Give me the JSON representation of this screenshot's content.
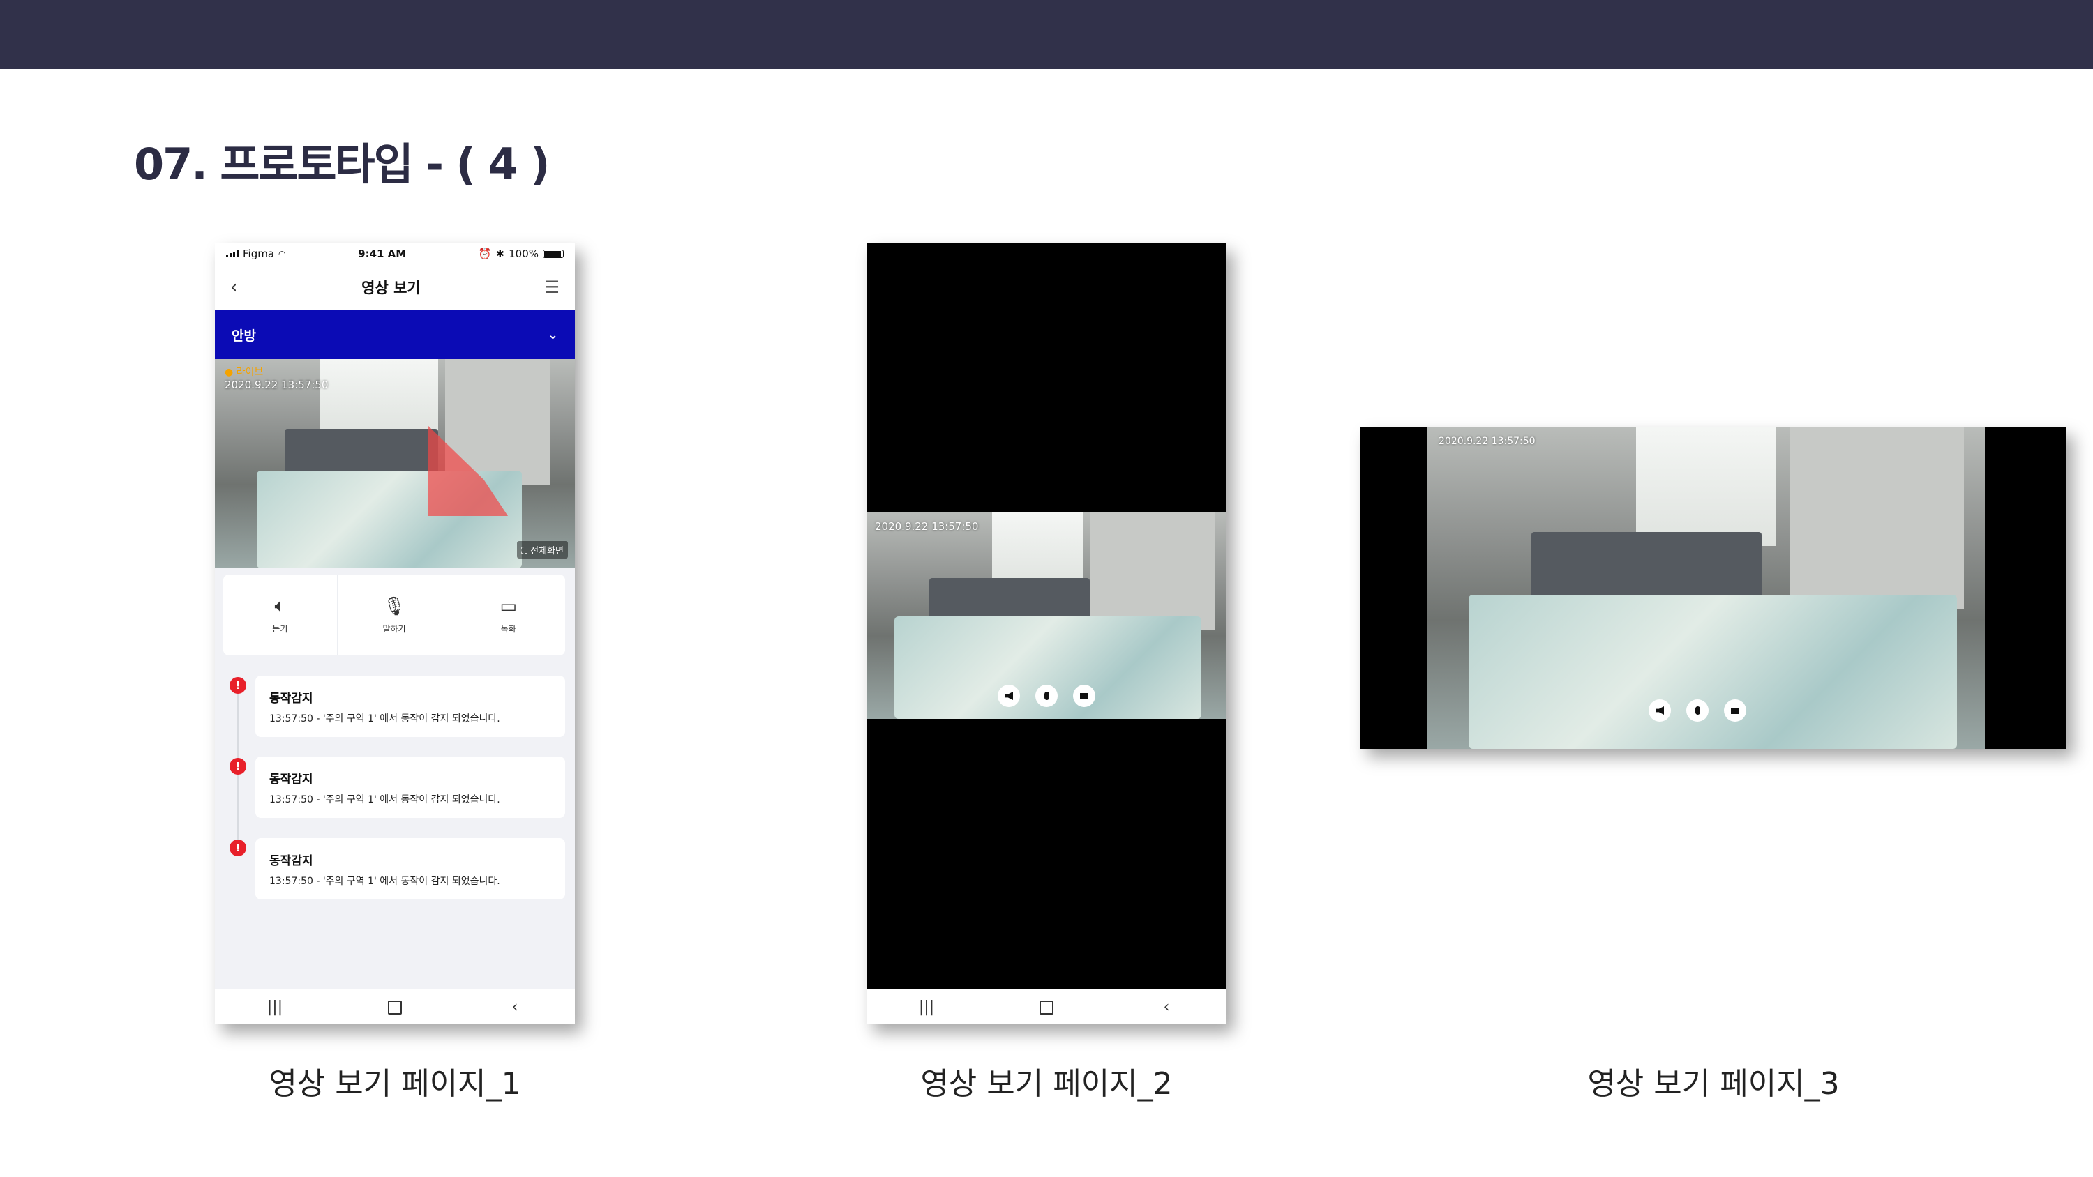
{
  "slide": {
    "title": "07. 프로토타입 - ( 4 )"
  },
  "phone1": {
    "status": {
      "carrier": "Figma",
      "time": "9:41 AM",
      "battery": "100%"
    },
    "appbar": {
      "title": "영상 보기"
    },
    "room": {
      "label": "안방"
    },
    "video": {
      "live_label": "● 라이브",
      "timestamp": "2020.9.22 13:57:50",
      "fullscreen_label": "전체화면"
    },
    "controls": [
      {
        "label": "듣기",
        "icon": "speaker-icon"
      },
      {
        "label": "말하기",
        "icon": "microphone-icon"
      },
      {
        "label": "녹화",
        "icon": "video-camera-icon"
      }
    ],
    "events": [
      {
        "name": "동작감지",
        "message": "13:57:50 - '주의 구역 1' 에서 동작이 감지 되었습니다."
      },
      {
        "name": "동작감지",
        "message": "13:57:50 - '주의 구역 1' 에서 동작이 감지 되었습니다."
      },
      {
        "name": "동작감지",
        "message": "13:57:50 - '주의 구역 1' 에서 동작이 감지 되었습니다."
      }
    ],
    "caption": "영상 보기 페이지_1"
  },
  "phone2": {
    "timestamp": "2020.9.22 13:57:50",
    "caption": "영상 보기 페이지_2"
  },
  "phone3": {
    "timestamp": "2020.9.22 13:57:50",
    "caption": "영상 보기 페이지_3"
  },
  "colors": {
    "topbar": "#31314a",
    "room_bar": "#0b0bb5",
    "alert": "#e8202a",
    "live": "#f5a300"
  }
}
